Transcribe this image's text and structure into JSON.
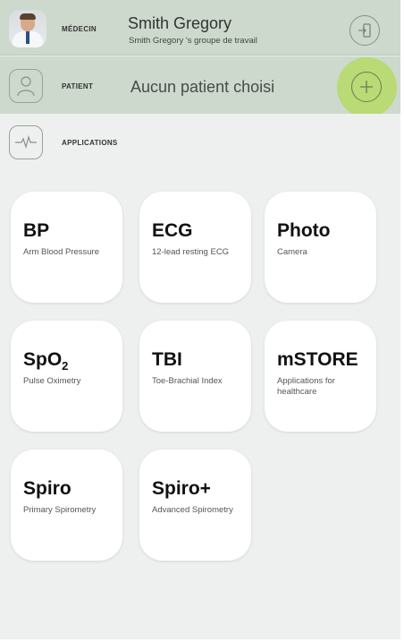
{
  "doctor": {
    "role_label": "MÉDECIN",
    "name": "Smith Gregory",
    "workgroup": "Smith Gregory 's groupe de travail"
  },
  "patient": {
    "role_label": "PATIENT",
    "status": "Aucun patient choisi"
  },
  "applications": {
    "section_label": "APPLICATIONS",
    "tiles": [
      {
        "title": "BP",
        "subtitle": "Arm Blood Pressure"
      },
      {
        "title": "ECG",
        "subtitle": "12-lead resting ECG"
      },
      {
        "title": "Photo",
        "subtitle": "Camera"
      },
      {
        "title_main": "SpO",
        "title_sub": "2",
        "subtitle": "Pulse Oximetry"
      },
      {
        "title": "TBI",
        "subtitle": "Toe-Brachial Index"
      },
      {
        "title": "mSTORE",
        "subtitle": "Applications for healthcare"
      },
      {
        "title": "Spiro",
        "subtitle": "Primary Spirometry"
      },
      {
        "title": "Spiro+",
        "subtitle": "Advanced Spirometry"
      }
    ]
  },
  "icons": {
    "logout": "logout-icon",
    "add_patient": "plus-icon",
    "patient": "person-icon",
    "applications": "pulse-icon"
  },
  "colors": {
    "header_bg": "#ccd9cc",
    "accent": "#b7d96a",
    "background": "#eef0ef"
  }
}
